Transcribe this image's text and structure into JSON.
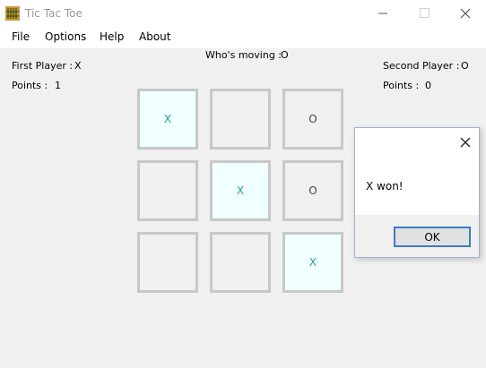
{
  "window": {
    "title": "Tic Tac Toe"
  },
  "menu": {
    "items": [
      "File",
      "Options",
      "Help",
      "About"
    ]
  },
  "status": {
    "whos_moving_label": "Who's moving :",
    "whos_moving_value": "O",
    "first_player_label": "First Player :",
    "first_player_value": "X",
    "first_points_label": "Points :",
    "first_points_value": "1",
    "second_player_label": "Second Player :",
    "second_player_value": "O",
    "second_points_label": "Points :",
    "second_points_value": "0"
  },
  "board": {
    "cells": [
      "X",
      "",
      "O",
      "",
      "X",
      "O",
      "",
      "",
      "X"
    ],
    "winning_cells": [
      0,
      4,
      8
    ]
  },
  "dialog": {
    "message": "X won!",
    "ok_label": "OK"
  },
  "colors": {
    "win_highlight": "#f0ffff",
    "win_mark": "#22a0a8",
    "cell_border": "#c8c8c8",
    "ok_border": "#3d7bc8"
  }
}
